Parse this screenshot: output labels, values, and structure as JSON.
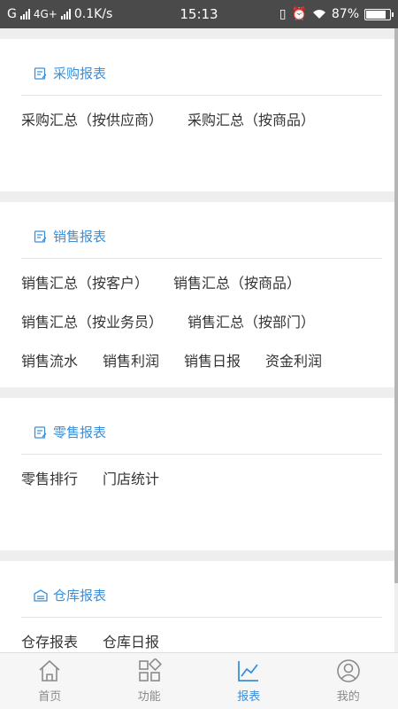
{
  "status_bar": {
    "carrier1": "G",
    "carrier2": "4G+",
    "speed": "0.1K/s",
    "time": "15:13",
    "battery_text": "87%",
    "battery_level": 0.87
  },
  "sections": {
    "purchase": {
      "title": "采购报表",
      "items": [
        "采购汇总（按供应商）",
        "采购汇总（按商品）"
      ]
    },
    "sales": {
      "title": "销售报表",
      "items": [
        "销售汇总（按客户）",
        "销售汇总（按商品）",
        "销售汇总（按业务员）",
        "销售汇总（按部门）",
        "销售流水",
        "销售利润",
        "销售日报",
        "资金利润"
      ]
    },
    "retail": {
      "title": "零售报表",
      "items": [
        "零售排行",
        "门店统计"
      ]
    },
    "warehouse": {
      "title": "仓库报表",
      "items": [
        "仓存报表",
        "仓库日报"
      ]
    }
  },
  "bottom_nav": {
    "items": [
      {
        "label": "首页",
        "icon": "home-icon"
      },
      {
        "label": "功能",
        "icon": "grid-icon"
      },
      {
        "label": "报表",
        "icon": "chart-icon"
      },
      {
        "label": "我的",
        "icon": "user-icon"
      }
    ],
    "active_index": 2
  },
  "colors": {
    "accent": "#3b8fd9",
    "status_bar_bg": "#4a4a4a",
    "text": "#333333"
  }
}
